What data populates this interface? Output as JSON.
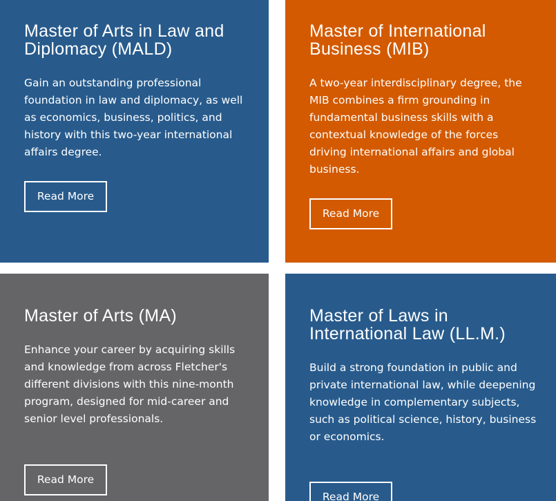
{
  "colors": {
    "blue": "#285b8c",
    "orange": "#d35a00",
    "gray": "#656568"
  },
  "programs": [
    {
      "title": "Master of Arts in Law and Diplomacy (MALD)",
      "description": "Gain an outstanding professional foundation in law and diplomacy, as well as economics, business, politics, and history with this two-year international affairs degree.",
      "button_label": "Read More"
    },
    {
      "title": "Master of International Business (MIB)",
      "description": "A two-year interdisciplinary degree, the MIB combines a firm grounding in fundamental business skills with a contextual knowledge of the forces driving international affairs and global business.",
      "button_label": "Read More"
    },
    {
      "title": "Master of Arts (MA)",
      "description": "Enhance your career by acquiring skills and knowledge from across Fletcher's different divisions with this nine-month program, designed for mid-career and senior level professionals.",
      "button_label": "Read More"
    },
    {
      "title": "Master of Laws in International Law (LL.M.)",
      "description": "Build a strong foundation in public and private international law, while deepening knowledge in complementary subjects, such as political science, history, business or economics.",
      "button_label": "Read More"
    }
  ]
}
